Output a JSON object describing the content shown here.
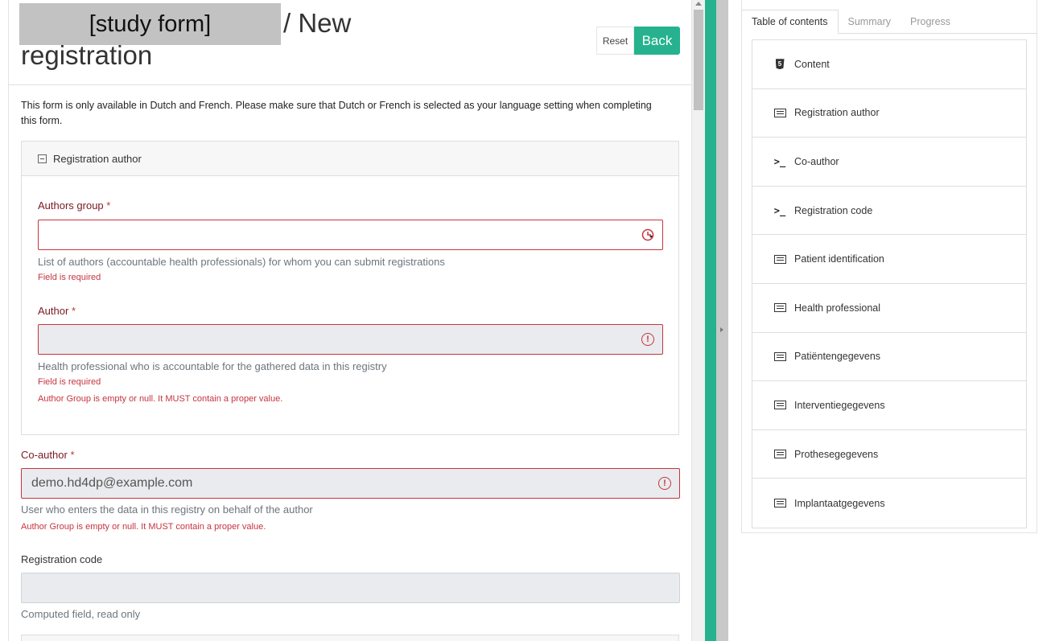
{
  "header": {
    "redacted_label": "[study form]",
    "title_suffix": "/ New",
    "title_line2": "registration",
    "reset_label": "Reset",
    "back_label": "Back"
  },
  "notice": "This form is only available in Dutch and French. Please make sure that Dutch or French is selected as your language setting when completing this form.",
  "section": {
    "title": "Registration author",
    "authors_group": {
      "label": "Authors group",
      "required_mark": "*",
      "value": "",
      "help": "List of authors (accountable health professionals) for whom you can submit registrations",
      "error": "Field is required"
    },
    "author": {
      "label": "Author",
      "required_mark": "*",
      "value": "",
      "help": "Health professional who is accountable for the gathered data in this registry",
      "error1": "Field is required",
      "error2": "Author Group is empty or null. It MUST contain a proper value."
    }
  },
  "coauthor": {
    "label": "Co-author",
    "required_mark": "*",
    "value": "demo.hd4dp@example.com",
    "help": "User who enters the data in this registry on behalf of the author",
    "error": "Author Group is empty or null. It MUST contain a proper value."
  },
  "registration_code": {
    "label": "Registration code",
    "value": "",
    "help": "Computed field, read only"
  },
  "sidebar": {
    "tabs": [
      {
        "label": "Table of contents",
        "active": true
      },
      {
        "label": "Summary",
        "active": false
      },
      {
        "label": "Progress",
        "active": false
      }
    ],
    "toc": [
      {
        "label": "Content",
        "icon": "html5-icon"
      },
      {
        "label": "Registration author",
        "icon": "list-icon"
      },
      {
        "label": "Co-author",
        "icon": "terminal-icon"
      },
      {
        "label": "Registration code",
        "icon": "terminal-icon"
      },
      {
        "label": "Patient identification",
        "icon": "list-icon"
      },
      {
        "label": "Health professional",
        "icon": "list-icon"
      },
      {
        "label": "Patiëntengegevens",
        "icon": "list-icon"
      },
      {
        "label": "Interventiegegevens",
        "icon": "list-icon"
      },
      {
        "label": "Prothesegegevens",
        "icon": "list-icon"
      },
      {
        "label": "Implantaatgegevens",
        "icon": "list-icon"
      }
    ]
  },
  "colors": {
    "accent": "#26b28e",
    "error": "#c7343f"
  }
}
